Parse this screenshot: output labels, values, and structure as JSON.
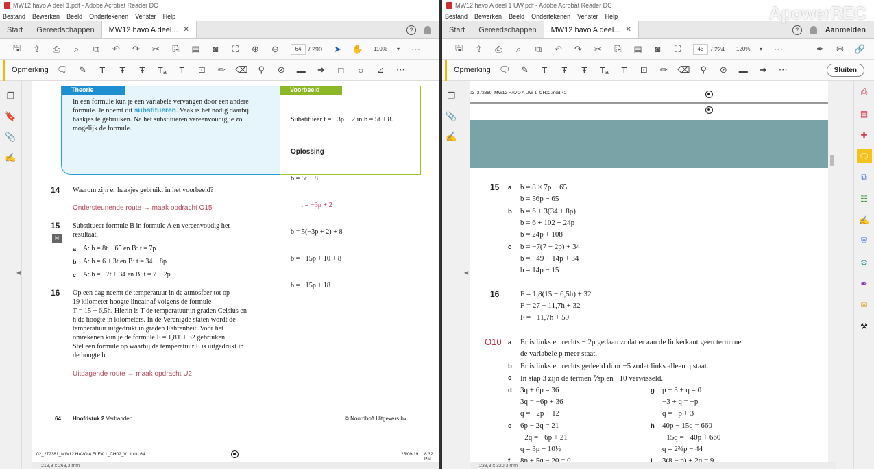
{
  "watermark": "ApowerREC",
  "left": {
    "title": "MW12 havo A deel 1.pdf - Adobe Acrobat Reader DC",
    "menu": [
      "Bestand",
      "Bewerken",
      "Beeld",
      "Ondertekenen",
      "Venster",
      "Help"
    ],
    "tabs": {
      "start": "Start",
      "tools": "Gereedschappen",
      "doc": "MW12 havo A deel..."
    },
    "page_current": "64",
    "page_total": "/ 290",
    "zoom": "110%",
    "annot_label": "Opmerking",
    "theory": {
      "header": "Theorie",
      "lines": [
        [
          "In een formule kun je een variabele vervangen door een andere"
        ],
        [
          "formule. Je noemt dit ",
          "substitueren",
          ". Vaak is het nodig daarbij"
        ],
        [
          "haakjes te gebruiken. Na het substitueren vereenvoudig je zo"
        ],
        [
          "mogelijk de formule."
        ]
      ]
    },
    "example": {
      "header": "Voorbeeld",
      "intro": "Substitueer t = −3p + 2 in b = 5t + 8.",
      "solution_title": "Oplossing",
      "lines": [
        "b = 5t + 8",
        "      t = −3p + 2",
        "b = 5(−3p + 2) + 8",
        "b = −15p + 10 + 8",
        "b = −15p + 18"
      ]
    },
    "q14": {
      "num": "14",
      "text": "Waarom zijn er haakjes gebruikt in het voorbeeld?",
      "route": "Ondersteunende route → maak opdracht O15"
    },
    "q15": {
      "num": "15",
      "badge": "H",
      "text": [
        "Substitueer formule B in formule A en vereenvoudig het",
        "resultaat."
      ],
      "parts": [
        {
          "label": "a",
          "text": "A: b = 8t − 65 en B: t = 7p"
        },
        {
          "label": "b",
          "text": "A: b = 6 + 3t en B: t = 34 + 8p"
        },
        {
          "label": "c",
          "text": "A: b = −7t + 34 en B: t = 7 − 2p"
        }
      ]
    },
    "q16": {
      "num": "16",
      "text": [
        "Op een dag neemt de temperatuur in de atmosfeer tot op",
        "19 kilometer hoogte lineair af volgens de formule",
        "T = 15 − 6,5h. Hierin is T de temperatuur in graden Celsius en",
        "h de hoogte in kilometers. In de Verenigde staten wordt de",
        "temperatuur uitgedrukt in graden Fahrenheit. Voor het",
        "omrekenen kun je de formule F = 1,8T + 32 gebruiken.",
        "Stel een formule op waarbij de temperatuur F is uitgedrukt in",
        "de hoogte h."
      ],
      "route": "Uitdagende route → maak opdracht U2"
    },
    "footer": {
      "page": "64",
      "chapter": "Hoofdstuk 2",
      "chapter_name": "Verbanden",
      "copyright": "© Noordhoff Uitgevers bv"
    },
    "slug": {
      "file": "02_272381_MW12 HAVO A FLEX 1_CH02_V1.indd   64",
      "date": "25/09/19",
      "time": "8:32 PM"
    },
    "status": "213,3 x 263,3 mm"
  },
  "right": {
    "title": "MW12 havo A deel 1 UW.pdf - Adobe Acrobat Reader DC",
    "menu": [
      "Bestand",
      "Bewerken",
      "Beeld",
      "Ondertekenen",
      "Venster",
      "Help"
    ],
    "tabs": {
      "start": "Start",
      "tools": "Gereedschappen",
      "doc": "MW12 havo A deel..."
    },
    "signin": "Aanmelden",
    "page_current": "43",
    "page_total": "/ 224",
    "zoom": "120%",
    "annot_label": "Opmerking",
    "close": "Sluiten",
    "slug": "03_272369_MW12 HAVO A UW 1_CH02.indd   42",
    "a15": {
      "num": "15",
      "groups": [
        {
          "label": "a",
          "lines": [
            "b = 8 × 7p − 65",
            "b = 56p − 65"
          ]
        },
        {
          "label": "b",
          "lines": [
            "b = 6 + 3(34 + 8p)",
            "b = 6 + 102 + 24p",
            "b = 24p + 108"
          ]
        },
        {
          "label": "c",
          "lines": [
            "b = −7(7 − 2p) + 34",
            "b = −49 + 14p + 34",
            "b = 14p − 15"
          ]
        }
      ]
    },
    "a16": {
      "num": "16",
      "lines": [
        "F = 1,8(15 − 6,5h) + 32",
        "F = 27 − 11,7h + 32",
        "F = −11,7h + 59"
      ]
    },
    "o10": {
      "num": "O10",
      "a": [
        "Er is links en rechts − 2p gedaan zodat er aan de linkerkant geen term met",
        "de variabele p meer staat."
      ],
      "b": "Er is links en rechts gedeeld door −5 zodat links alleen q staat.",
      "c": "In stap 3 zijn de termen ⅖p en −10 verwisseld.",
      "d": [
        "3q + 6p = 36",
        "3q = −6p + 36",
        "q = −2p + 12"
      ],
      "e": [
        "6p − 2q = 21",
        "−2q = −6p + 21",
        "q = 3p − 10½"
      ],
      "f": "8p + 5q − 20 = 0",
      "g": [
        "p − 3 + q = 0",
        "−3 + q = −p",
        "q = −p + 3"
      ],
      "h": [
        "40p − 15q = 660",
        "−15q = −40p + 660",
        "q = 2⅔p − 44"
      ],
      "i": "3(8 − p) + 2q = 9"
    },
    "status": "233,3 x 320,3 mm"
  }
}
